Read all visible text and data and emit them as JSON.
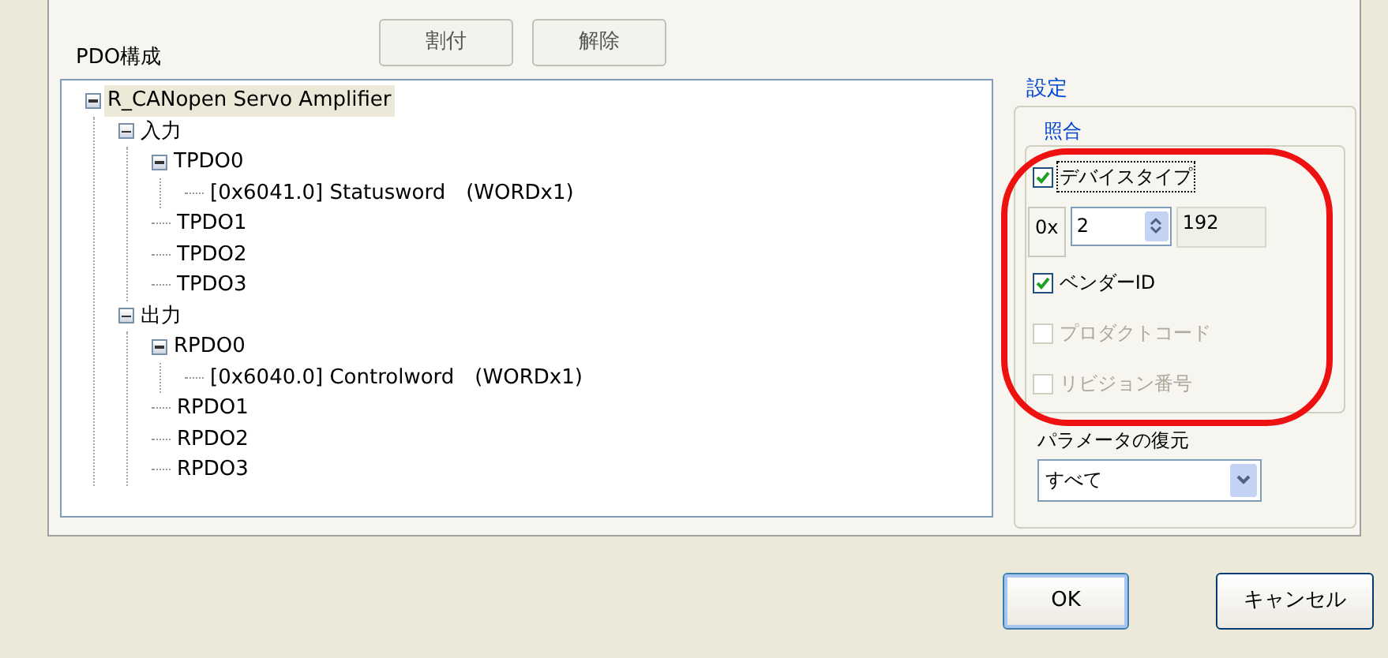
{
  "pdo": {
    "title": "PDO構成",
    "buttons": [
      {
        "label": "割付"
      },
      {
        "label": "解除"
      }
    ],
    "tree": [
      {
        "label": "R_CANopen Servo Amplifier",
        "selected": true,
        "expanded": true,
        "children": [
          {
            "label": "入力",
            "selected": false,
            "expanded": true,
            "children": [
              {
                "label": "TPDO0",
                "selected": false,
                "expanded": true,
                "children": [
                  {
                    "label": "[0x6041.0] Statusword　(WORDx1)",
                    "selected": false
                  }
                ]
              },
              {
                "label": "TPDO1",
                "selected": false
              },
              {
                "label": "TPDO2",
                "selected": false
              },
              {
                "label": "TPDO3",
                "selected": false
              }
            ]
          },
          {
            "label": "出力",
            "selected": false,
            "expanded": true,
            "children": [
              {
                "label": "RPDO0",
                "selected": false,
                "expanded": true,
                "children": [
                  {
                    "label": "[0x6040.0] Controlword　(WORDx1)",
                    "selected": false
                  }
                ]
              },
              {
                "label": "RPDO1",
                "selected": false
              },
              {
                "label": "RPDO2",
                "selected": false
              },
              {
                "label": "RPDO3",
                "selected": false
              }
            ]
          }
        ]
      }
    ]
  },
  "settings": {
    "title": "設定",
    "match": {
      "title": "照合",
      "items": [
        {
          "kind": "checkbox",
          "label": "デバイスタイプ",
          "checked": true,
          "disabled": false,
          "focused": true
        },
        {
          "kind": "spinner",
          "prefix": "0x",
          "value": "2",
          "readout": "192"
        },
        {
          "kind": "checkbox",
          "label": "ベンダーID",
          "checked": true,
          "disabled": false,
          "focused": false
        },
        {
          "kind": "checkbox",
          "label": "プロダクトコード",
          "checked": false,
          "disabled": true,
          "focused": false
        },
        {
          "kind": "checkbox",
          "label": "リビジョン番号",
          "checked": false,
          "disabled": true,
          "focused": false
        }
      ]
    },
    "restore": {
      "label": "パラメータの復元",
      "value": "すべて"
    }
  },
  "buttons": [
    {
      "label": "OK",
      "default": true
    },
    {
      "label": "キャンセル",
      "default": false
    }
  ]
}
